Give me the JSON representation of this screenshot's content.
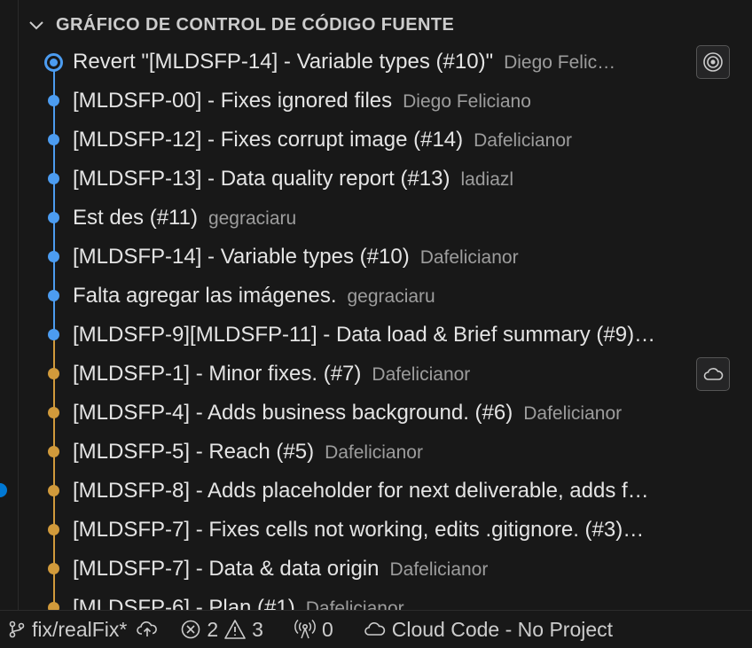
{
  "panel": {
    "title": "GRÁFICO DE CONTROL DE CÓDIGO FUENTE"
  },
  "colors": {
    "blue_lane": "#4c9cf0",
    "orange_lane": "#d19a3b",
    "gutter_indicator": "#0078d4"
  },
  "commits": [
    {
      "message": "Revert \"[MLDSFP-14] - Variable types (#10)\"",
      "author": "Diego Felic…",
      "lane": "blue",
      "head": true,
      "badge": "target-icon"
    },
    {
      "message": "[MLDSFP-00] - Fixes ignored files",
      "author": "Diego Feliciano",
      "lane": "blue"
    },
    {
      "message": "[MLDSFP-12] - Fixes corrupt image (#14)",
      "author": "Dafelicianor",
      "lane": "blue"
    },
    {
      "message": "[MLDSFP-13] - Data quality report (#13)",
      "author": "ladiazl",
      "lane": "blue"
    },
    {
      "message": "Est des (#11)",
      "author": "gegraciaru",
      "lane": "blue"
    },
    {
      "message": "[MLDSFP-14] - Variable types (#10)",
      "author": "Dafelicianor",
      "lane": "blue"
    },
    {
      "message": "Falta agregar las imágenes.",
      "author": "gegraciaru",
      "lane": "blue"
    },
    {
      "message": "[MLDSFP-9][MLDSFP-11] - Data load & Brief summary (#9)…",
      "author": "",
      "lane": "blue"
    },
    {
      "message": "[MLDSFP-1] - Minor fixes. (#7)",
      "author": "Dafelicianor",
      "lane": "orange",
      "badge": "cloud-icon"
    },
    {
      "message": "[MLDSFP-4] - Adds business background. (#6)",
      "author": "Dafelicianor",
      "lane": "orange"
    },
    {
      "message": "[MLDSFP-5] - Reach (#5)",
      "author": "Dafelicianor",
      "lane": "orange"
    },
    {
      "message": "[MLDSFP-8] - Adds placeholder for next deliverable, adds f…",
      "author": "",
      "lane": "orange"
    },
    {
      "message": "[MLDSFP-7] - Fixes cells not working, edits .gitignore. (#3)…",
      "author": "",
      "lane": "orange"
    },
    {
      "message": "[MLDSFP-7] -  Data & data origin",
      "author": "Dafelicianor",
      "lane": "orange"
    },
    {
      "message": "[MLDSFP-6] - Plan (#1)",
      "author": "Dafelicianor",
      "lane": "orange"
    }
  ],
  "statusbar": {
    "branch": "fix/realFix*",
    "errors": "2",
    "warnings": "3",
    "ports": "0",
    "cloud": "Cloud Code - No Project"
  }
}
